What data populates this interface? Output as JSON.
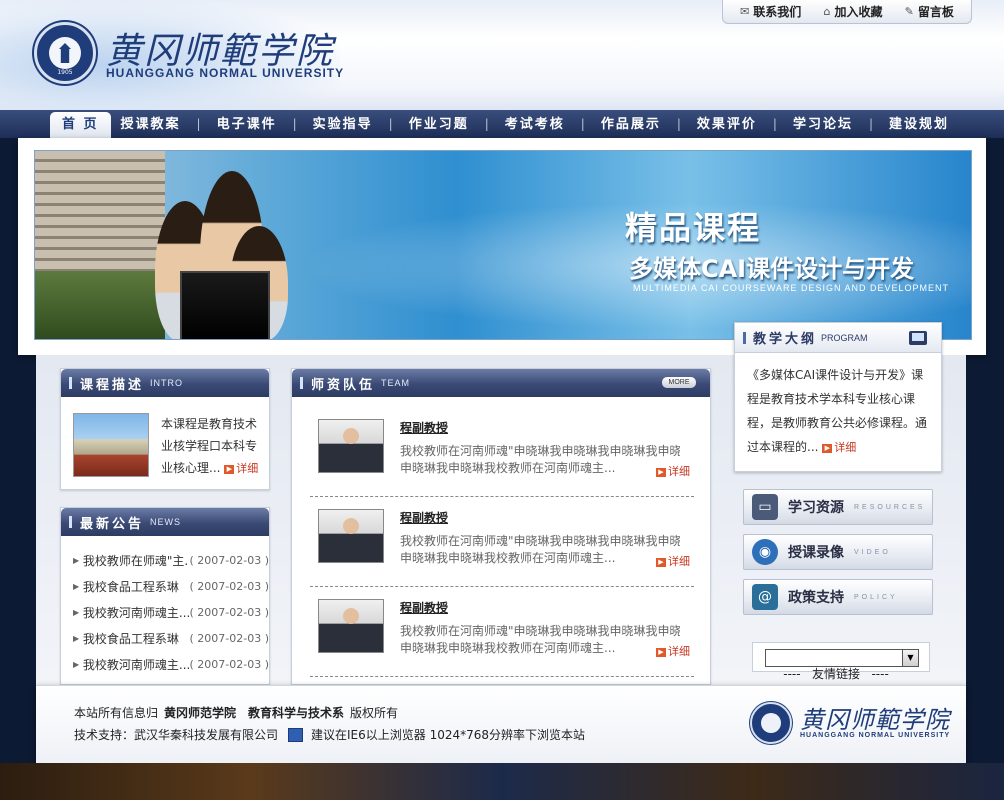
{
  "header": {
    "logo_cn": "黄冈师範学院",
    "logo_en": "HUANGGANG NORMAL UNIVERSITY",
    "seal_year": "1905",
    "top_links": [
      {
        "label": "联系我们",
        "icon": "envelope-icon"
      },
      {
        "label": "加入收藏",
        "icon": "home-icon"
      },
      {
        "label": "留言板",
        "icon": "message-icon"
      }
    ]
  },
  "nav": {
    "items": [
      "首 页",
      "授课教案",
      "电子课件",
      "实验指导",
      "作业习题",
      "考试考核",
      "作品展示",
      "效果评价",
      "学习论坛",
      "建设规划"
    ],
    "separator": "|"
  },
  "banner": {
    "title": "精品课程",
    "subtitle": "多媒体CAI课件设计与开发",
    "subtitle_en": "MULTIMEDIA CAI COURSEWARE DESIGN AND DEVELOPMENT"
  },
  "detail_label": "详细",
  "intro": {
    "title": "课程描述",
    "title_en": "INTRO",
    "text": "本课程是教育技术业核学程口本科专业核心理..."
  },
  "news": {
    "title": "最新公告",
    "title_en": "NEWS",
    "items": [
      {
        "title": "我校教师在师魂\"主...",
        "date": "( 2007-02-03 )"
      },
      {
        "title": "我校食品工程系琳",
        "date": "( 2007-02-03 )"
      },
      {
        "title": "我校教河南师魂主...",
        "date": "( 2007-02-03 )"
      },
      {
        "title": "我校食品工程系琳",
        "date": "( 2007-02-03 )"
      },
      {
        "title": "我校教河南师魂主...",
        "date": "( 2007-02-03 )"
      }
    ]
  },
  "team": {
    "title": "师资队伍",
    "title_en": "TEAM",
    "more_label": "MORE",
    "members": [
      {
        "name": "程副教授",
        "line1": "我校教师在河南师魂\"申晓琳我申晓琳我申晓琳我申晓",
        "line2": "申晓琳我申晓琳我校教师在河南师魂主..."
      },
      {
        "name": "程副教授",
        "line1": "我校教师在河南师魂\"申晓琳我申晓琳我申晓琳我申晓",
        "line2": "申晓琳我申晓琳我校教师在河南师魂主..."
      },
      {
        "name": "程副教授",
        "line1": "我校教师在河南师魂\"申晓琳我申晓琳我申晓琳我申晓",
        "line2": "申晓琳我申晓琳我校教师在河南师魂主..."
      }
    ]
  },
  "program": {
    "title": "教学大纲",
    "title_en": "PROGRAM",
    "text": "《多媒体CAI课件设计与开发》课程是教育技术学本科专业核心课程，是教师教育公共必修课程。通过本课程的..."
  },
  "resources": [
    {
      "cn": "学习资源",
      "en": "RESOURCES",
      "icon": "monitor-icon",
      "color": "#4a5a78"
    },
    {
      "cn": "授课录像",
      "en": "VIDEO",
      "icon": "disc-icon",
      "color": "#2d6fb8"
    },
    {
      "cn": "政策支持",
      "en": "POLICY",
      "icon": "book-icon",
      "color": "#2a6f9a"
    }
  ],
  "links_select": "----   友情链接   ----",
  "footer": {
    "line1_prefix": "本站所有信息归",
    "line1_school": "黄冈师范学院",
    "line1_dept": "教育科学与技术系",
    "line1_suffix": "版权所有",
    "line2_support": "技术支持：武汉华秦科技发展有限公司",
    "line2_browser": "建议在IE6以上浏览器 1024*768分辨率下浏览本站",
    "logo_cn": "黄冈师範学院",
    "logo_en": "HUANGGANG NORMAL UNIVERSITY"
  }
}
